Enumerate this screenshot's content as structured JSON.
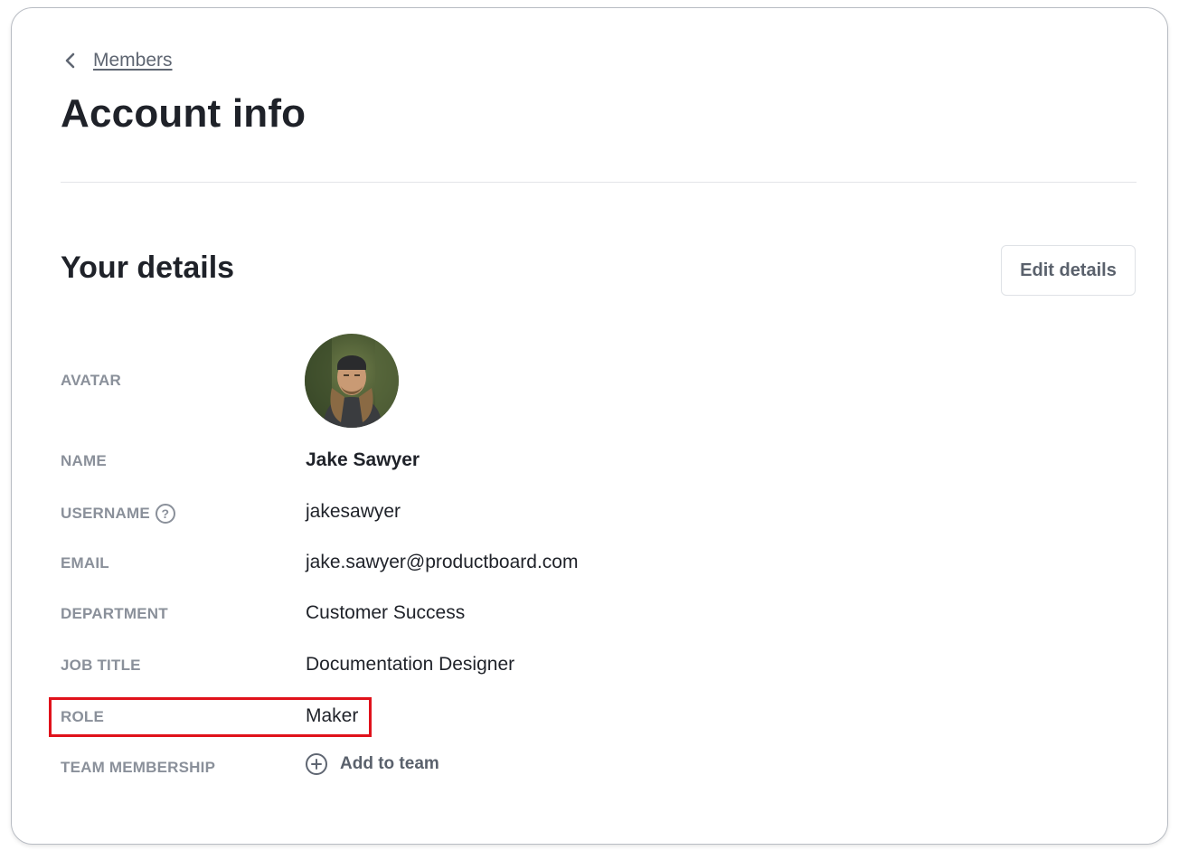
{
  "breadcrumb": {
    "back_label": "Members"
  },
  "page": {
    "title": "Account info"
  },
  "details": {
    "section_title": "Your details",
    "edit_button": "Edit details",
    "fields": {
      "avatar": {
        "label": "AVATAR"
      },
      "name": {
        "label": "NAME",
        "value": "Jake Sawyer"
      },
      "username": {
        "label": "USERNAME",
        "value": "jakesawyer"
      },
      "email": {
        "label": "EMAIL",
        "value": "jake.sawyer@productboard.com"
      },
      "department": {
        "label": "DEPARTMENT",
        "value": "Customer Success"
      },
      "job_title": {
        "label": "JOB TITLE",
        "value": "Documentation Designer"
      },
      "role": {
        "label": "ROLE",
        "value": "Maker"
      },
      "team_membership": {
        "label": "TEAM MEMBERSHIP",
        "add_label": "Add to team"
      }
    }
  },
  "icons": {
    "back": "chevron-left-icon",
    "help": "question-circle-icon",
    "add": "plus-circle-icon"
  },
  "colors": {
    "highlight": "#e0121b",
    "label": "#8a909a",
    "text": "#1f2229"
  }
}
